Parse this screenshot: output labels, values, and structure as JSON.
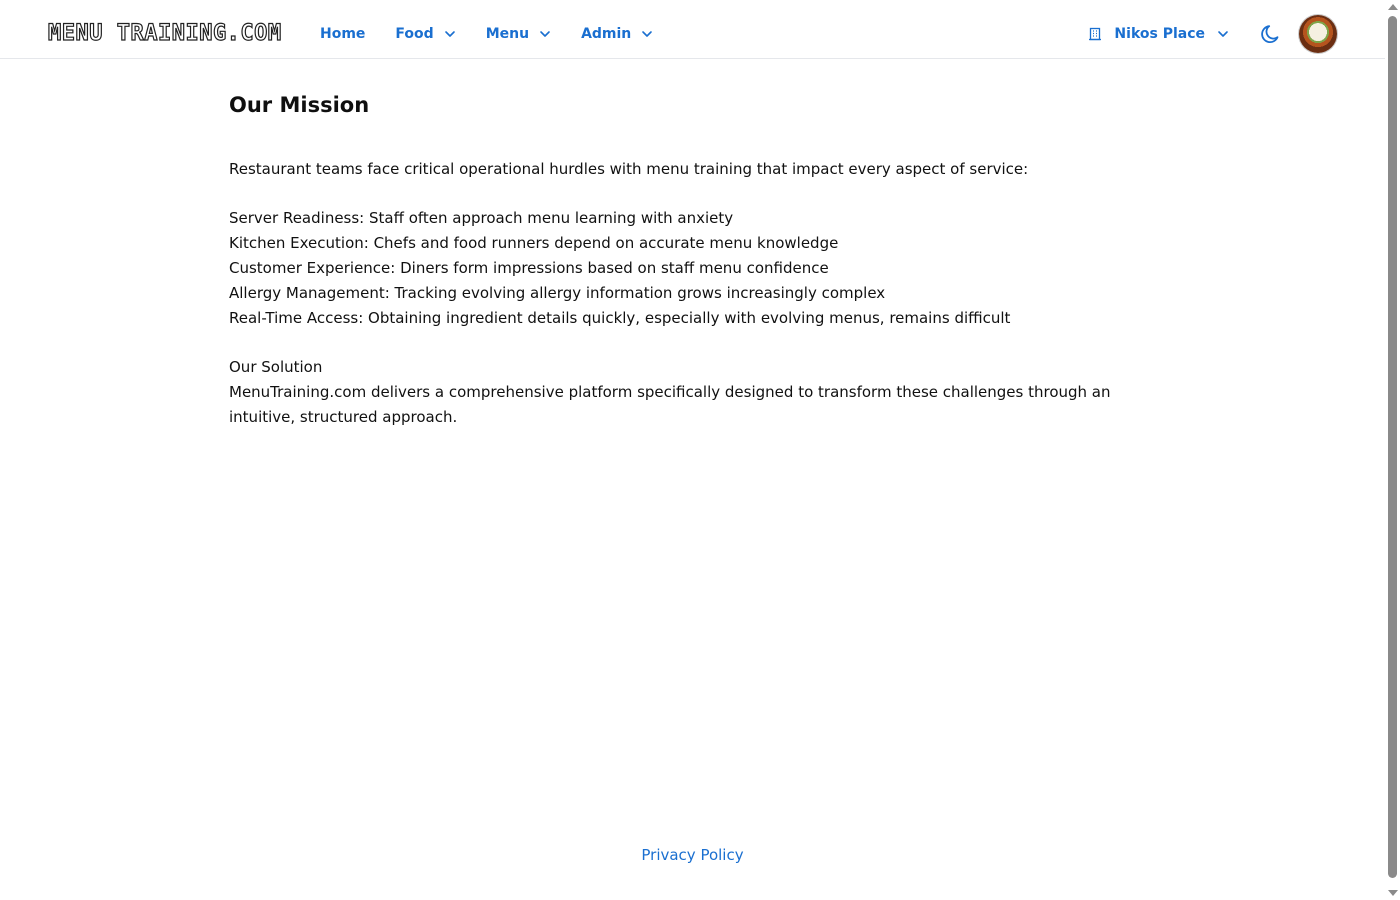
{
  "header": {
    "logo_text": "MENU TRAINING.COM",
    "nav": [
      {
        "label": "Home",
        "has_dropdown": false
      },
      {
        "label": "Food",
        "has_dropdown": true
      },
      {
        "label": "Menu",
        "has_dropdown": true
      },
      {
        "label": "Admin",
        "has_dropdown": true
      }
    ],
    "org_selector": {
      "label": "Nikos Place",
      "icon": "building-icon"
    },
    "theme_toggle_icon": "moon-icon",
    "accent_color": "#1a6fd0"
  },
  "main": {
    "title": "Our Mission",
    "intro": "Restaurant teams face critical operational hurdles with menu training that impact every aspect of service:",
    "challenges": [
      "Server Readiness: Staff often approach menu learning with anxiety",
      "Kitchen Execution: Chefs and food runners depend on accurate menu knowledge",
      "Customer Experience: Diners form impressions based on staff menu confidence",
      "Allergy Management: Tracking evolving allergy information grows increasingly complex",
      "Real-Time Access: Obtaining ingredient details quickly, especially with evolving menus, remains difficult"
    ],
    "solution_heading": "Our Solution",
    "solution_text": "MenuTraining.com delivers a comprehensive platform specifically designed to transform these challenges through an intuitive, structured approach."
  },
  "footer": {
    "privacy_link": "Privacy Policy"
  }
}
